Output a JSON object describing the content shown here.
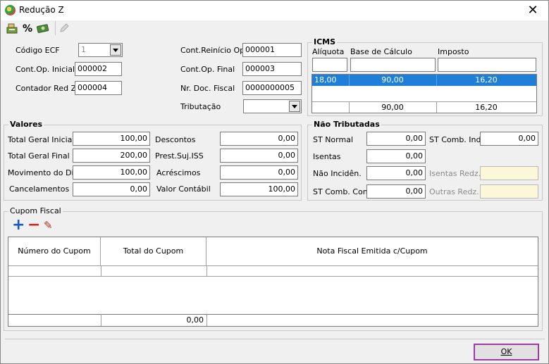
{
  "window": {
    "title": "Redução Z",
    "close_glyph": "✕"
  },
  "toolbar": {
    "icons": [
      "cash-register-icon",
      "percent-icon",
      "money-icon",
      "pencil-disabled-icon"
    ],
    "percent_glyph": "%"
  },
  "header": {
    "codigo_ecf_label": "Código ECF",
    "codigo_ecf_value": "1",
    "cont_op_inicial_label": "Cont.Op. Inicial",
    "cont_op_inicial_value": "000002",
    "contador_red_z_label": "Contador Red Z",
    "contador_red_z_value": "000004",
    "cont_reinicio_label": "Cont.Reinício Op.",
    "cont_reinicio_value": "000001",
    "cont_op_final_label": "Cont.Op. Final",
    "cont_op_final_value": "000003",
    "nr_doc_fiscal_label": "Nr. Doc. Fiscal",
    "nr_doc_fiscal_value": "0000000005",
    "tributacao_label": "Tributação",
    "tributacao_value": ""
  },
  "icms": {
    "title": "ICMS",
    "col_aliquota": "Alíquota",
    "col_base": "Base de Cálculo",
    "col_imposto": "Imposto",
    "row": {
      "aliquota": "18,00",
      "base": "90,00",
      "imposto": "16,20"
    },
    "total": {
      "base": "90,00",
      "imposto": "16,20"
    }
  },
  "valores": {
    "title": "Valores",
    "total_geral_inicial_label": "Total Geral Inicial",
    "total_geral_inicial": "100,00",
    "total_geral_final_label": "Total Geral Final",
    "total_geral_final": "200,00",
    "movimento_label": "Movimento do Dia",
    "movimento": "100,00",
    "cancelamentos_label": "Cancelamentos",
    "cancelamentos": "0,00",
    "descontos_label": "Descontos",
    "descontos": "0,00",
    "prest_iss_label": "Prest.Suj.ISS",
    "prest_iss": "0,00",
    "acrescimos_label": "Acréscimos",
    "acrescimos": "0,00",
    "valor_contabil_label": "Valor Contábil",
    "valor_contabil": "100,00"
  },
  "nao_tributadas": {
    "title": "Não Tributadas",
    "st_normal_label": "ST Normal",
    "st_normal": "0,00",
    "isentas_label": "Isentas",
    "isentas": "0,00",
    "nao_incid_label": "Não Incidên.",
    "nao_incid": "0,00",
    "st_comb_cons_label": "ST Comb. Cons",
    "st_comb_cons": "0,00",
    "st_comb_ind_label": "ST Comb. Ind.",
    "st_comb_ind": "0,00",
    "isentas_redz_label": "Isentas Redz.",
    "isentas_redz": "",
    "outras_redz_label": "Outras Redz.",
    "outras_redz": ""
  },
  "cupom": {
    "title": "Cupom Fiscal",
    "col_numero": "Número do Cupom",
    "col_total": "Total do Cupom",
    "col_nota": "Nota Fiscal Emitida c/Cupom",
    "footer_total": "0,00",
    "add_glyph": "+",
    "remove_glyph": "−",
    "edit_glyph": "✎"
  },
  "ok_label": "OK",
  "colors": {
    "selection": "#1f7fd8",
    "ok_border": "#9b3ba5",
    "add": "#1a56c8",
    "remove": "#d42020"
  }
}
